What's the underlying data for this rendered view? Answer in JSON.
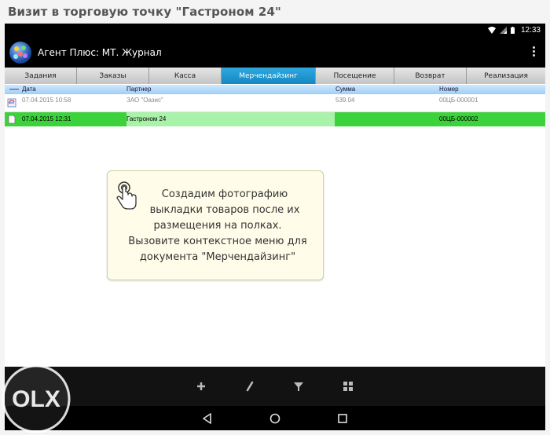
{
  "page_title": "Визит в торговую точку \"Гастроном 24\"",
  "status_bar": {
    "time": "12:33",
    "icons": [
      "wifi-icon",
      "signal-icon",
      "battery-icon"
    ]
  },
  "app_bar": {
    "title": "Агент Плюс: МТ. Журнал",
    "logo_icon": "app-logo-icon",
    "menu_icon": "overflow-menu-icon"
  },
  "tabs": [
    {
      "label": "Задания",
      "active": false
    },
    {
      "label": "Заказы",
      "active": false
    },
    {
      "label": "Касса",
      "active": false
    },
    {
      "label": "Мерчендайзинг",
      "active": true
    },
    {
      "label": "Посещение",
      "active": false
    },
    {
      "label": "Возврат",
      "active": false
    },
    {
      "label": "Реализация",
      "active": false
    }
  ],
  "table": {
    "columns": [
      "Дата",
      "Партнер",
      "Сумма",
      "Номер"
    ],
    "rows": [
      {
        "date": "07.04.2015 10:58",
        "partner": "ЗАО \"Оазис\"",
        "sum": "539.04",
        "number": "00ЦБ-000001",
        "selected": false
      },
      {
        "date": "07.04.2015 12:31",
        "partner": "Гастроном 24",
        "sum": "",
        "number": "00ЦБ-000002",
        "selected": true
      }
    ]
  },
  "hint": {
    "lines": [
      "Создадим фотографию",
      "выкладки товаров после их",
      "размещения на полках.",
      "Вызовите контекстное меню для",
      "документа \"Мерчендайзинг\""
    ],
    "icon": "hand-pointer-icon"
  },
  "bottom_actions": [
    "add-icon",
    "edit-icon",
    "filter-icon",
    "grid-icon"
  ],
  "nav": [
    "back-icon",
    "home-icon",
    "recents-icon"
  ],
  "watermark": "OLX",
  "colors": {
    "active_tab": "#1e98d3",
    "selected_row": "#3bd23b",
    "header": "#b5dcf8",
    "callout_bg": "#fffde9"
  }
}
